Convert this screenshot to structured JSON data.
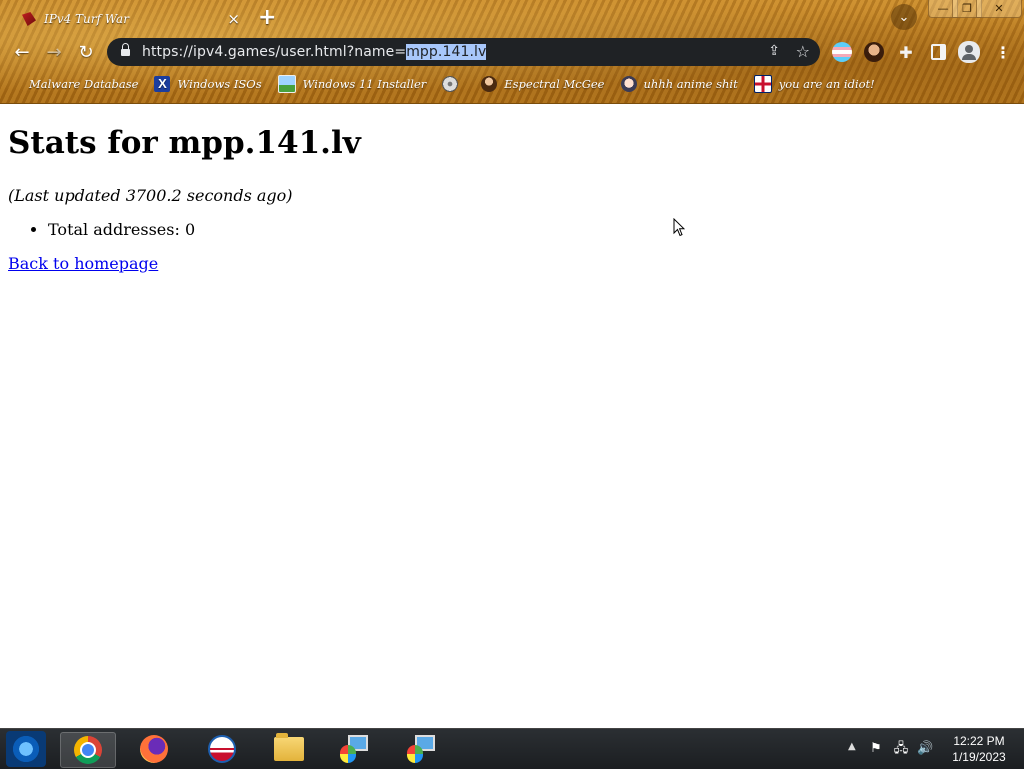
{
  "browser": {
    "tab_title": "IPv4 Turf War",
    "tab_close": "×",
    "new_tab": "+",
    "url_prefix": "https://ipv4.games/user.html?name=",
    "url_selected": "mpp.141.lv",
    "bookmarks": [
      {
        "label": "Malware Database",
        "icon": "none"
      },
      {
        "label": "Windows ISOs",
        "icon": "x"
      },
      {
        "label": "Windows 11 Installer",
        "icon": "img"
      },
      {
        "label": "",
        "icon": "disk"
      },
      {
        "label": "Espectral McGee",
        "icon": "man"
      },
      {
        "label": "uhhh anime shit",
        "icon": "anime"
      },
      {
        "label": "you are an idiot!",
        "icon": "ukflag"
      }
    ]
  },
  "page": {
    "heading": "Stats for mpp.141.lv",
    "updated": "(Last updated 3700.2 seconds ago)",
    "stats": [
      "Total addresses: 0"
    ],
    "back_link": "Back to homepage"
  },
  "taskbar": {
    "time": "12:22 PM",
    "date": "1/19/2023"
  }
}
